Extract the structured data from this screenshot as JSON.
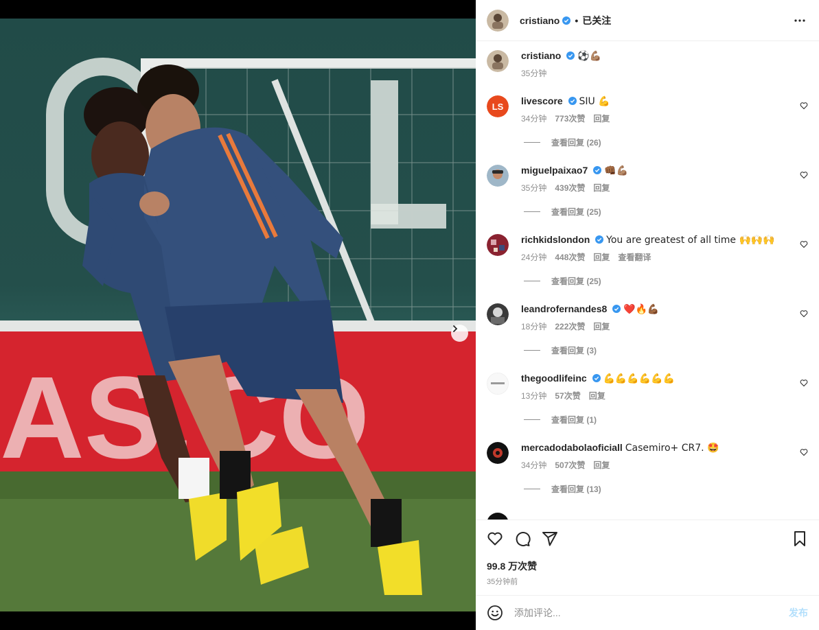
{
  "post": {
    "author": "cristiano",
    "follow_status": "已关注",
    "separator": "•",
    "caption": {
      "username": "cristiano",
      "text": "⚽💪🏽",
      "time": "35分钟"
    },
    "likes": "99.8 万次赞",
    "posted_time": "35分钟前",
    "carousel": {
      "count": 2,
      "active": 0
    }
  },
  "comments": [
    {
      "username": "livescore",
      "verified": true,
      "text": "SIU 💪",
      "time": "34分钟",
      "likes": "773次赞",
      "reply": "回复",
      "view_replies": "查看回复 (26)",
      "avatar_color": "#e8491d",
      "avatar_text": "LS"
    },
    {
      "username": "miguelpaixao7",
      "verified": true,
      "text": "👊🏾💪🏽",
      "time": "35分钟",
      "likes": "439次赞",
      "reply": "回复",
      "view_replies": "查看回复 (25)",
      "avatar_color": "#6c8ea8",
      "avatar_text": ""
    },
    {
      "username": "richkidslondon",
      "verified": true,
      "text": "You are greatest of all time 🙌🙌🙌",
      "time": "24分钟",
      "likes": "448次赞",
      "reply": "回复",
      "translate": "查看翻译",
      "view_replies": "查看回复 (25)",
      "avatar_color": "#8a2230",
      "avatar_text": ""
    },
    {
      "username": "leandrofernandes8",
      "verified": true,
      "text": "❤️🔥💪🏾",
      "time": "18分钟",
      "likes": "222次赞",
      "reply": "回复",
      "view_replies": "查看回复 (3)",
      "avatar_color": "#3a3a3a",
      "avatar_text": ""
    },
    {
      "username": "thegoodlifeinc",
      "verified": true,
      "text": "💪💪💪💪💪💪",
      "time": "13分钟",
      "likes": "57次赞",
      "reply": "回复",
      "view_replies": "查看回复 (1)",
      "avatar_color": "#f4f4f4",
      "avatar_text": ""
    },
    {
      "username": "mercadodabolaoficiall",
      "verified": false,
      "text": "Casemiro+ CR7. 🤩",
      "time": "34分钟",
      "likes": "507次赞",
      "reply": "回复",
      "view_replies": "查看回复 (13)",
      "avatar_color": "#111111",
      "avatar_text": ""
    }
  ],
  "composer": {
    "placeholder": "添加评论...",
    "post_label": "发布"
  },
  "icons": {
    "like": "heart-icon",
    "comment": "comment-icon",
    "share": "share-icon",
    "save": "bookmark-icon",
    "emoji": "smiley-icon",
    "more": "more-icon",
    "next": "chevron-right-icon"
  },
  "colors": {
    "verified": "#3897f0",
    "muted": "#8e8e8e",
    "post_button": "#b2dffc"
  }
}
